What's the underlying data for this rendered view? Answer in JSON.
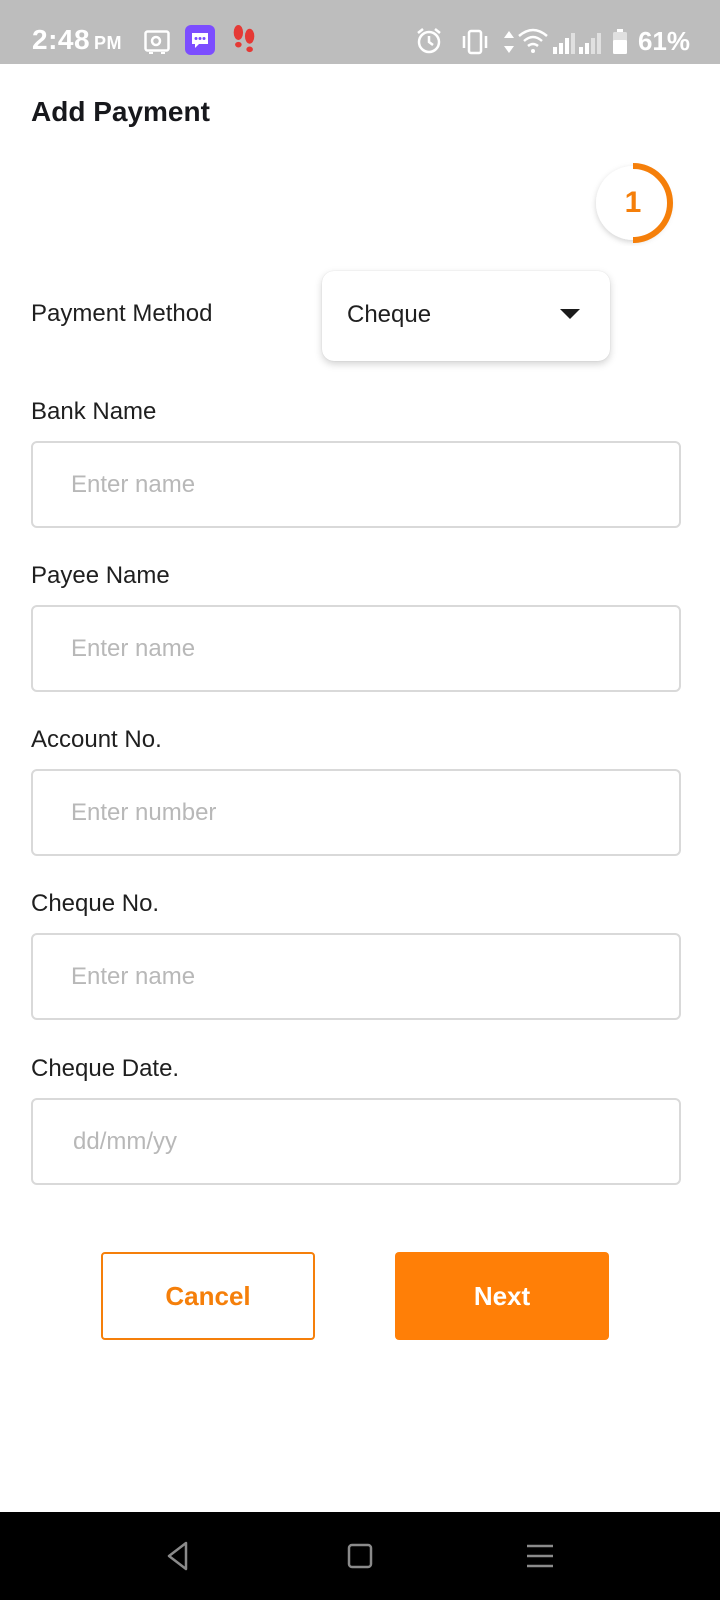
{
  "status_bar": {
    "time": "2:48",
    "ampm": "PM",
    "battery": "61%",
    "icons": [
      "voicemail-icon",
      "chat-app-icon",
      "footsteps-icon",
      "alarm-icon",
      "vibrate-icon",
      "data-arrows-icon",
      "wifi-icon",
      "signal-icon",
      "signal-icon",
      "battery-icon"
    ],
    "bg_color": "#bdbdbd"
  },
  "page": {
    "title": "Add Payment",
    "step": "1",
    "accent_color": "#f57f0a"
  },
  "form": {
    "payment_method": {
      "label": "Payment Method",
      "value": "Cheque"
    },
    "bank_name": {
      "label": "Bank Name",
      "placeholder": "Enter name",
      "value": ""
    },
    "payee_name": {
      "label": "Payee Name",
      "placeholder": "Enter name",
      "value": ""
    },
    "account_no": {
      "label": "Account No.",
      "placeholder": "Enter number",
      "value": ""
    },
    "cheque_no": {
      "label": "Cheque No.",
      "placeholder": "Enter name",
      "value": ""
    },
    "cheque_date": {
      "label": "Cheque Date.",
      "placeholder": "dd/mm/yy",
      "value": ""
    }
  },
  "actions": {
    "cancel_label": "Cancel",
    "next_label": "Next"
  },
  "nav_bar": {
    "icons": [
      "back-icon",
      "home-icon",
      "recents-icon"
    ]
  }
}
